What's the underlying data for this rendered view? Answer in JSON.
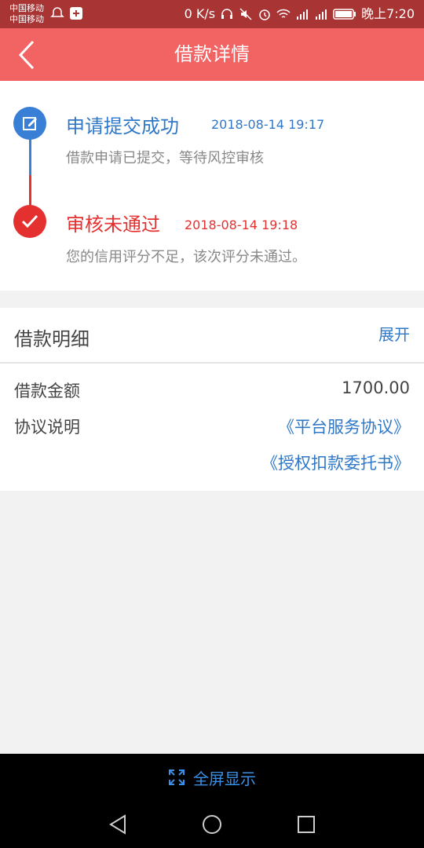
{
  "statusbar": {
    "carrier1": "中国移动",
    "carrier2": "中国移动",
    "speed": "0 K/s",
    "time": "晚上7:20"
  },
  "header": {
    "title": "借款详情",
    "back_icon": "chevron-left-icon"
  },
  "timeline": {
    "step1": {
      "title": "申请提交成功",
      "time": "2018-08-14 19:17",
      "desc": "借款申请已提交，等待风控审核",
      "icon": "edit-icon",
      "color": "#3a7fd6"
    },
    "step2": {
      "title": "审核未通过",
      "time": "2018-08-14 19:18",
      "desc": "您的信用评分不足，该次评分未通过。",
      "icon": "check-icon",
      "color": "#e53030"
    }
  },
  "detail": {
    "title": "借款明细",
    "expand_label": "展开",
    "amount_label": "借款金额",
    "amount_value": "1700.00",
    "agreement_label": "协议说明",
    "agreement_link1": "《平台服务协议》",
    "agreement_link2": "《授权扣款委托书》"
  },
  "footer": {
    "fullscreen_label": "全屏显示",
    "fullscreen_icon": "expand-icon"
  },
  "colors": {
    "header": "#f26464",
    "statusbar": "#a93434",
    "link": "#2f78c8",
    "error": "#e53030"
  }
}
